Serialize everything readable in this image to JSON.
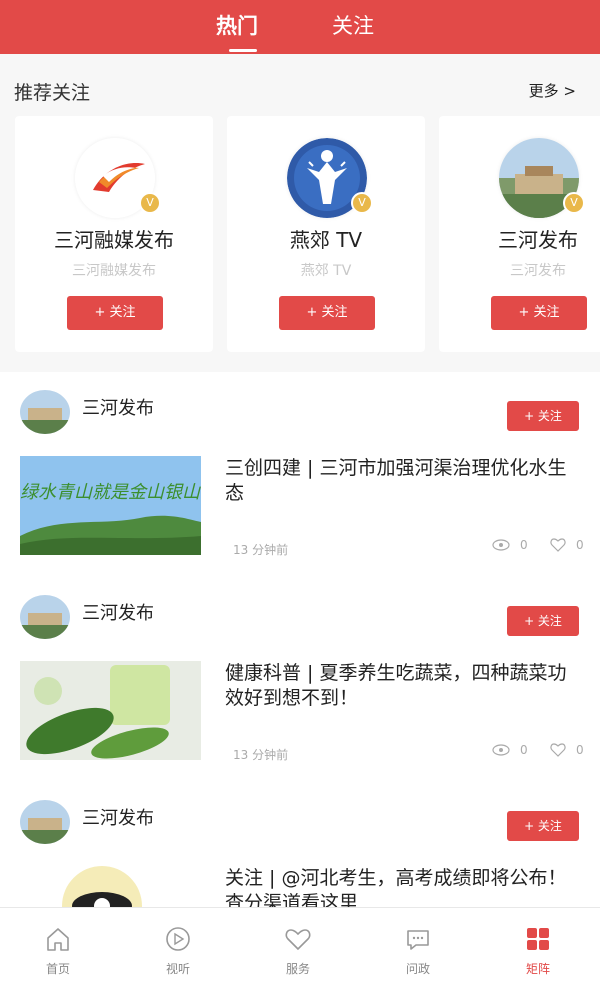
{
  "header": {
    "tabs": [
      {
        "label": "热门"
      },
      {
        "label": "关注"
      }
    ]
  },
  "recommend": {
    "title": "推荐关注",
    "more": "更多 >",
    "cards": [
      {
        "name": "三河融媒发布",
        "sub": "三河融媒发布",
        "follow": "+ 关注"
      },
      {
        "name": "燕郊 TV",
        "sub": "燕郊 TV",
        "follow": "+ 关注"
      },
      {
        "name": "三河发布",
        "sub": "三河发布",
        "follow": "+ 关注"
      }
    ]
  },
  "posts": [
    {
      "author": "三河发布",
      "follow": "+ 关注",
      "title": "三创四建 | 三河市加强河渠治理优化水生态",
      "time": "13 分钟前",
      "views": "0",
      "likes": "0",
      "thumb_text": "绿水青山就是金山银山"
    },
    {
      "author": "三河发布",
      "follow": "+ 关注",
      "title": "健康科普 | 夏季养生吃蔬菜，四种蔬菜功效好到想不到！",
      "time": "13 分钟前",
      "views": "0",
      "likes": "0"
    },
    {
      "author": "三河发布",
      "follow": "+ 关注",
      "title": "关注 | @河北考生，高考成绩即将公布！查分渠道看这里"
    }
  ],
  "nav": [
    {
      "label": "首页",
      "icon": "home-icon"
    },
    {
      "label": "视听",
      "icon": "play-icon"
    },
    {
      "label": "服务",
      "icon": "heart-icon"
    },
    {
      "label": "问政",
      "icon": "chat-icon"
    },
    {
      "label": "矩阵",
      "icon": "grid-icon",
      "active": true
    }
  ],
  "colors": {
    "accent": "#e24a48",
    "badge": "#e9b84a"
  }
}
